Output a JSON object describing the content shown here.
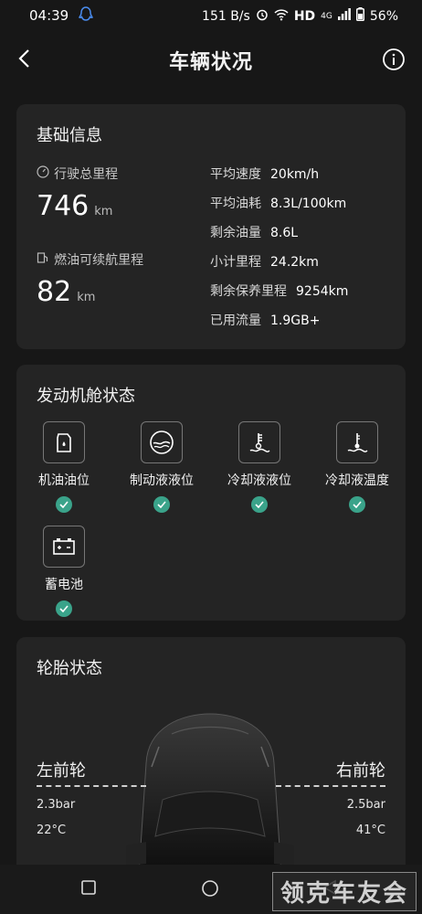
{
  "status_bar": {
    "time": "04:39",
    "net_speed": "151 B/s",
    "hd": "HD",
    "network": "4G",
    "battery": "56%"
  },
  "app_bar": {
    "title": "车辆状况"
  },
  "basic_info": {
    "title": "基础信息",
    "odometer_label": "行驶总里程",
    "odometer_value": "746",
    "odometer_unit": "km",
    "range_label": "燃油可续航里程",
    "range_value": "82",
    "range_unit": "km",
    "stats": [
      {
        "label": "平均速度",
        "value": "20km/h"
      },
      {
        "label": "平均油耗",
        "value": "8.3L/100km"
      },
      {
        "label": "剩余油量",
        "value": "8.6L"
      },
      {
        "label": "小计里程",
        "value": "24.2km"
      },
      {
        "label": "剩余保养里程",
        "value": "9254km"
      },
      {
        "label": "已用流量",
        "value": "1.9GB+"
      }
    ]
  },
  "engine": {
    "title": "发动机舱状态",
    "items": [
      {
        "label": "机油油位",
        "icon": "oil-can-icon"
      },
      {
        "label": "制动液液位",
        "icon": "brake-fluid-icon"
      },
      {
        "label": "冷却液液位",
        "icon": "coolant-level-icon"
      },
      {
        "label": "冷却液温度",
        "icon": "coolant-temp-icon"
      },
      {
        "label": "蓄电池",
        "icon": "battery-icon"
      }
    ]
  },
  "tires": {
    "title": "轮胎状态",
    "front_left": {
      "label": "左前轮",
      "pressure": "2.3bar",
      "temp": "22°C"
    },
    "front_right": {
      "label": "右前轮",
      "pressure": "2.5bar",
      "temp": "41°C"
    }
  },
  "watermark": "领克车友会",
  "colors": {
    "accent_check": "#3aa38a",
    "card_bg": "#242424",
    "page_bg": "#171717"
  }
}
